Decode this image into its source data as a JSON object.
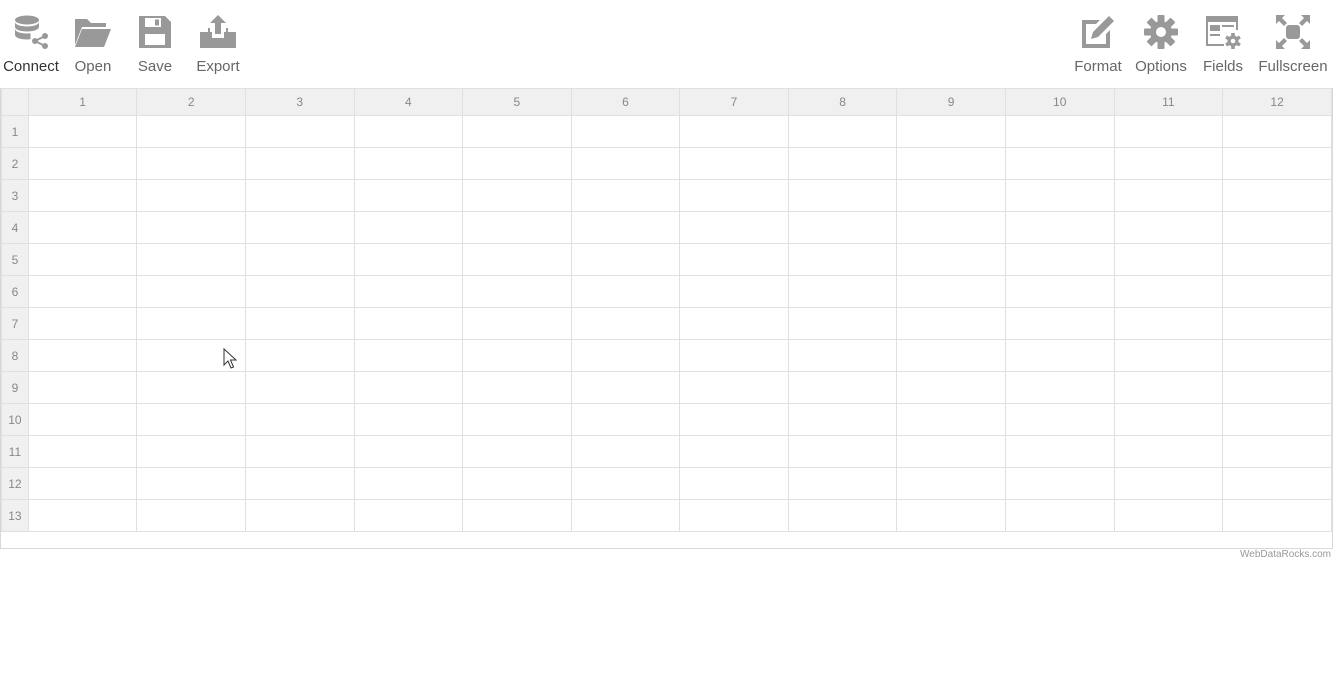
{
  "toolbar": {
    "left": [
      {
        "label": "Connect",
        "icon": "database-share-icon"
      },
      {
        "label": "Open",
        "icon": "folder-icon"
      },
      {
        "label": "Save",
        "icon": "floppy-disk-icon"
      },
      {
        "label": "Export",
        "icon": "export-tray-icon"
      }
    ],
    "right": [
      {
        "label": "Format",
        "icon": "edit-pencil-icon"
      },
      {
        "label": "Options",
        "icon": "gear-icon"
      },
      {
        "label": "Fields",
        "icon": "fields-layout-icon"
      },
      {
        "label": "Fullscreen",
        "icon": "fullscreen-icon"
      }
    ]
  },
  "grid": {
    "columns": [
      "1",
      "2",
      "3",
      "4",
      "5",
      "6",
      "7",
      "8",
      "9",
      "10",
      "11",
      "12"
    ],
    "rows": [
      "1",
      "2",
      "3",
      "4",
      "5",
      "6",
      "7",
      "8",
      "9",
      "10",
      "11",
      "12",
      "13"
    ]
  },
  "credit": "WebDataRocks.com",
  "colors": {
    "icon": "#999999",
    "header_bg": "#f0f0f0",
    "grid_line": "#e0e0e0"
  }
}
